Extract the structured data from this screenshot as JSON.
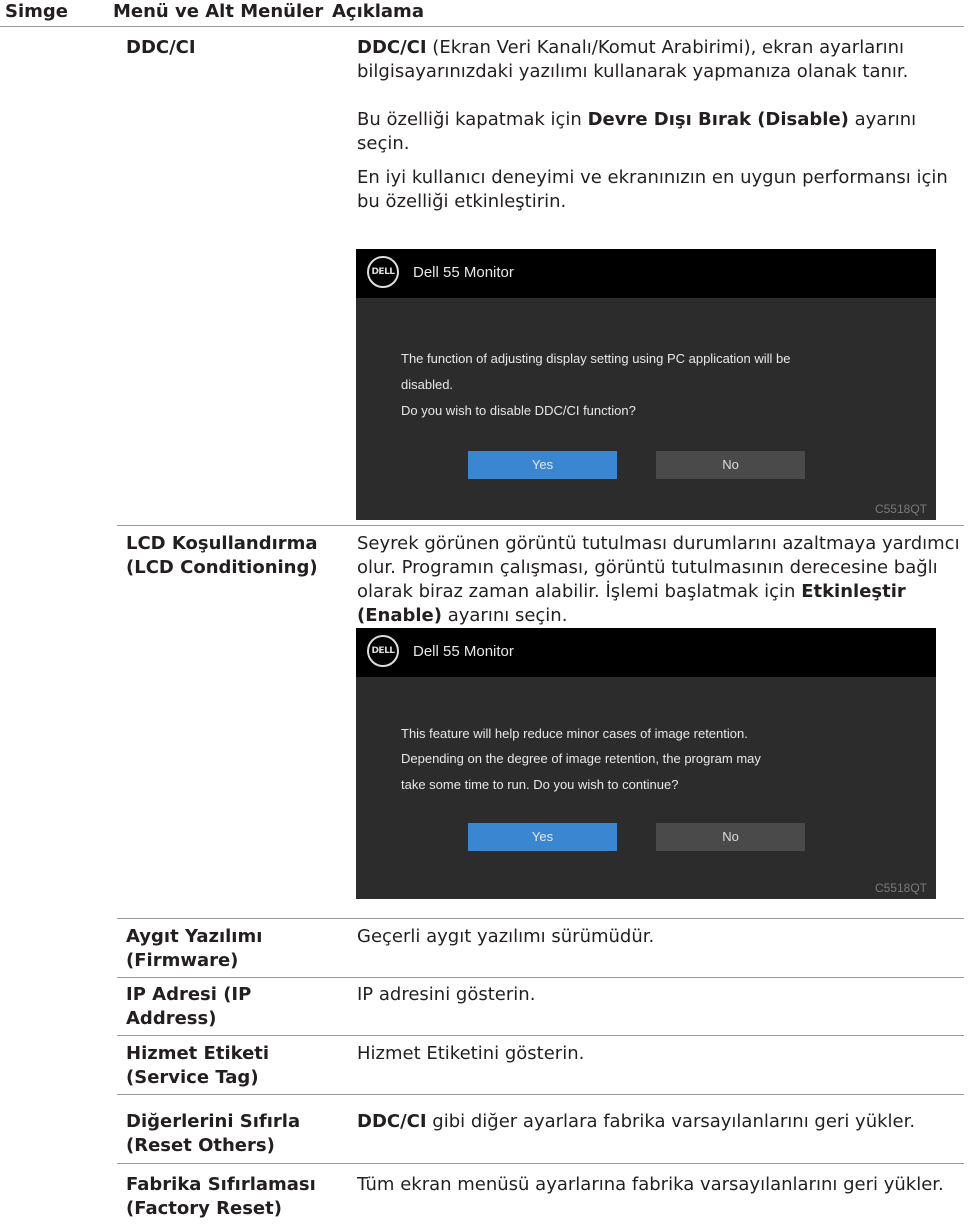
{
  "header": {
    "col_icon": "Simge",
    "col_menu": "Menü ve Alt Menüler",
    "col_desc": "Açıklama"
  },
  "rows": {
    "ddcci": {
      "menu": "DDC/CI",
      "p1_bold": "DDC/CI",
      "p1_text": " (Ekran Veri Kanalı/Komut Arabirimi), ekran ayarlarını bilgisayarınızdaki yazılımı kullanarak yapmanıza olanak tanır.",
      "p2_pre": "Bu özelliği kapatmak için ",
      "p2_bold": "Devre Dışı Bırak (Disable)",
      "p2_post": " ayarını seçin.",
      "p3": "En iyi kullanıcı deneyimi ve ekranınızın en uygun performansı için bu özelliği etkinleştirin.",
      "dialog": {
        "logo": "DELL",
        "title": "Dell 55 Monitor",
        "line1": "The function of adjusting display setting using PC application will be",
        "line2": "disabled.",
        "line3": "Do you wish to disable DDC/CI function?",
        "yes": "Yes",
        "no": "No",
        "model": "C5518QT"
      }
    },
    "lcd": {
      "menu_line1": "LCD Koşullandırma",
      "menu_line2": "(LCD Conditioning)",
      "p1_text": "Seyrek görünen görüntü tutulması durumlarını azaltmaya yardımcı olur. Programın çalışması, görüntü tutulmasının derecesine bağlı olarak biraz zaman alabilir. İşlemi başlatmak için ",
      "p1_bold": "Etkinleştir (Enable)",
      "p1_post": " ayarını seçin.",
      "dialog": {
        "logo": "DELL",
        "title": "Dell 55 Monitor",
        "line1": "This feature will help reduce minor cases of image retention.",
        "line2": "Depending on the degree of image retention, the program may",
        "line3": "take some time to run. Do you wish to continue?",
        "yes": "Yes",
        "no": "No",
        "model": "C5518QT"
      }
    },
    "firmware": {
      "menu_line1": "Aygıt Yazılımı",
      "menu_line2": "(Firmware)",
      "desc": "Geçerli aygıt yazılımı sürümüdür."
    },
    "ip": {
      "menu_line1": "IP Adresi (IP",
      "menu_line2": "Address)",
      "desc": "IP adresini gösterin."
    },
    "service": {
      "menu_line1": "Hizmet Etiketi",
      "menu_line2": "(Service Tag)",
      "desc": "Hizmet Etiketini gösterin."
    },
    "reset_others": {
      "menu_line1": "Diğerlerini Sıfırla",
      "menu_line2": "(Reset Others)",
      "desc_bold": "DDC/CI",
      "desc_text": " gibi diğer ayarlara fabrika varsayılanlarını geri yükler."
    },
    "factory_reset": {
      "menu_line1": "Fabrika Sıfırlaması",
      "menu_line2": "(Factory Reset)",
      "desc": "Tüm ekran menüsü ayarlarına fabrika varsayılanlarını geri yükler."
    }
  },
  "colors": {
    "dialog_bg": "#2c2c2c",
    "titlebar": "#000000",
    "yes_button": "#3b86d0",
    "no_button": "#4a4a4a"
  }
}
